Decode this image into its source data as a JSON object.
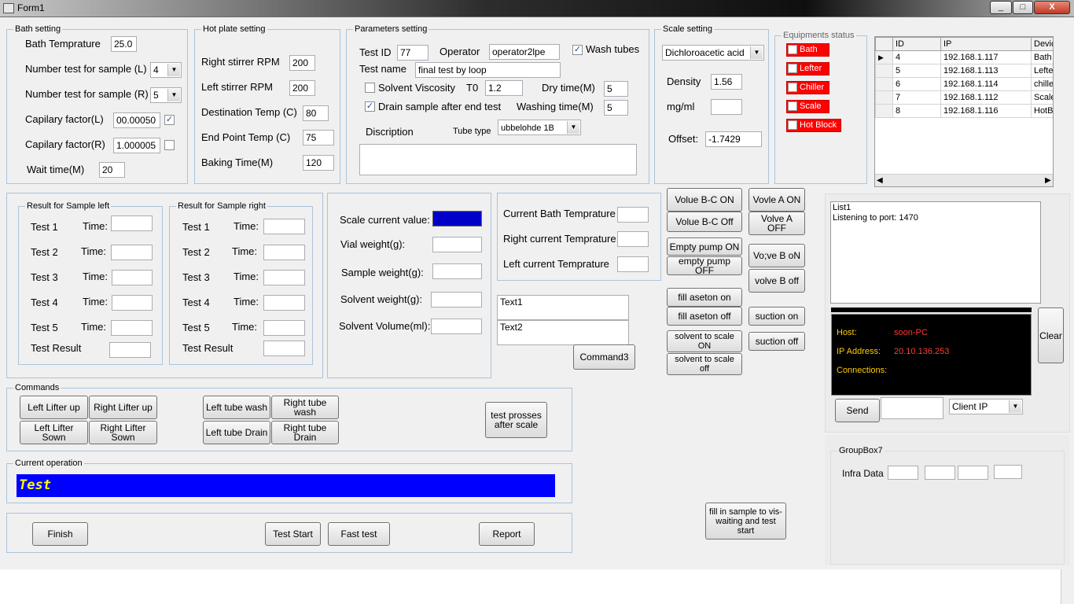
{
  "window": {
    "title": "Form1",
    "minimize": "_",
    "maximize": "□",
    "close": "X"
  },
  "bath": {
    "legend": "Bath setting",
    "temp_label": "Bath Temprature",
    "temp_value": "25.0",
    "num_left_label": "Number test for sample (L)",
    "num_left_value": "4",
    "num_right_label": "Number test for sample (R)",
    "num_right_value": "5",
    "capL_label": "Capilary factor(L)",
    "capL_value": "00.00050",
    "capR_label": "Capilary factor(R)",
    "capR_value": "1.000005",
    "wait_label": "Wait time(M)",
    "wait_value": "20"
  },
  "hotplate": {
    "legend": "Hot plate setting",
    "right_rpm_label": "Right stirrer RPM",
    "right_rpm_value": "200",
    "left_rpm_label": "Left stirrer RPM",
    "left_rpm_value": "200",
    "dest_label": "Destination Temp (C)",
    "dest_value": "80",
    "end_label": "End Point Temp (C)",
    "end_value": "75",
    "bake_label": "Baking Time(M)",
    "bake_value": "120"
  },
  "params": {
    "legend": "Parameters setting",
    "testid_label": "Test ID",
    "testid_value": "77",
    "operator_label": "Operator",
    "operator_value": "operator2lpe",
    "wash_label": "Wash tubes",
    "testname_label": "Test name",
    "testname_value": "final test by loop",
    "viscosity_label": "Solvent Viscosity",
    "t0_label": "T0",
    "t0_value": "1.2",
    "dry_label": "Dry time(M)",
    "dry_value": "5",
    "drain_label": "Drain sample after end test",
    "washing_label": "Washing time(M)",
    "washing_value": "5",
    "desc_label": "Discription",
    "tubetype_label": "Tube type",
    "tubetype_value": "ubbelohde 1B"
  },
  "scale": {
    "legend": "Scale setting",
    "acid_value": "Dichloroacetic acid",
    "density_label": "Density",
    "density_value": "1.56",
    "mgml_label": "mg/ml",
    "offset_label": "Offset:",
    "offset_value": "-1.7429"
  },
  "equipments": {
    "legend": "Equipments status",
    "items": [
      "Bath",
      "Lefter",
      "Chiller",
      "Scale",
      "Hot Block"
    ]
  },
  "ipgrid": {
    "headers": [
      "ID",
      "IP",
      "Devic"
    ],
    "rows": [
      {
        "id": "4",
        "ip": "192.168.1.117",
        "dev": "Bath"
      },
      {
        "id": "5",
        "ip": "192.168.1.113",
        "dev": "Lefte"
      },
      {
        "id": "6",
        "ip": "192.168.1.114",
        "dev": "chiller"
      },
      {
        "id": "7",
        "ip": "192.168.1.112",
        "dev": "Scale"
      },
      {
        "id": "8",
        "ip": "192.168.1.116",
        "dev": "HotBl"
      }
    ],
    "selected_marker": "▶"
  },
  "results_left": {
    "legend": "Result for Sample left",
    "tests": [
      "Test 1",
      "Test 2",
      "Test 3",
      "Test 4",
      "Test 5"
    ],
    "time_label": "Time:",
    "result_label": "Test Result"
  },
  "results_right": {
    "legend": "Result for Sample right",
    "tests": [
      "Test 1",
      "Test 2",
      "Test 3",
      "Test 4",
      "Test 5"
    ],
    "time_label": "Time:",
    "result_label": "Test Result"
  },
  "weights": {
    "scale_current_label": "Scale current value:",
    "scale_current_color": "#0000c8",
    "vial_label": "Vial weight(g):",
    "sample_label": "Sample weight(g):",
    "solvent_label": "Solvent weight(g):",
    "volume_label": "Solvent Volume(ml):"
  },
  "current_temps": {
    "bath_label": "Current Bath Temprature",
    "right_label": "Right current Temprature",
    "left_label": "Left current Temprature"
  },
  "texts": {
    "text1": "Text1",
    "text2": "Text2",
    "command3": "Command3"
  },
  "valves": {
    "volue_bc_on": "Volue B-C ON",
    "volue_bc_off": "Volue B-C Off",
    "vovle_a_on": "Vovle A ON",
    "volve_a_off": "Volve A OFF",
    "empty_on": "Empty pump ON",
    "empty_off": "empty pump OFF",
    "voveb_on": "Vo;ve B oN",
    "volveb_off": "volve B off",
    "fill_on": "fill aseton on",
    "fill_off": "fill aseton off",
    "suction_on": "suction on",
    "suction_off": "suction off",
    "solvent_on": "solvent to scale ON",
    "solvent_off": "solvent to scale off"
  },
  "list": {
    "lines": [
      "List1",
      "Listening to port: 1470"
    ]
  },
  "host": {
    "host_label": "Host:",
    "host_value": "soon-PC",
    "ip_label": "IP Address:",
    "ip_value": "20.10.136.253",
    "conn_label": "Connections:",
    "clear": "Clear",
    "send": "Send",
    "client_ip": "Client IP"
  },
  "groupbox7": {
    "legend": "GroupBox7",
    "infra_label": "Infra Data"
  },
  "commands": {
    "legend": "Commands",
    "left_lifter_up": "Left Lifter up",
    "right_lifter_up": "Right Lifter up",
    "left_lifter_down": "Left Lifter Sown",
    "right_lifter_down": "Right Lifter Sown",
    "left_tube_wash": "Left tube wash",
    "right_tube_wash": "Right tube wash",
    "left_tube_drain": "Left tube Drain",
    "right_tube_drain": "Right tube Drain",
    "test_after_scale": "test prosses after scale"
  },
  "current_op": {
    "legend": "Current operation",
    "value": "Test",
    "bg": "#0000ff",
    "fg": "#ffff00"
  },
  "bottom": {
    "finish": "Finish",
    "test_start": "Test Start",
    "fast_test": "Fast test",
    "report": "Report",
    "fill_sample": "fill in sample to vis-waiting and test start"
  }
}
